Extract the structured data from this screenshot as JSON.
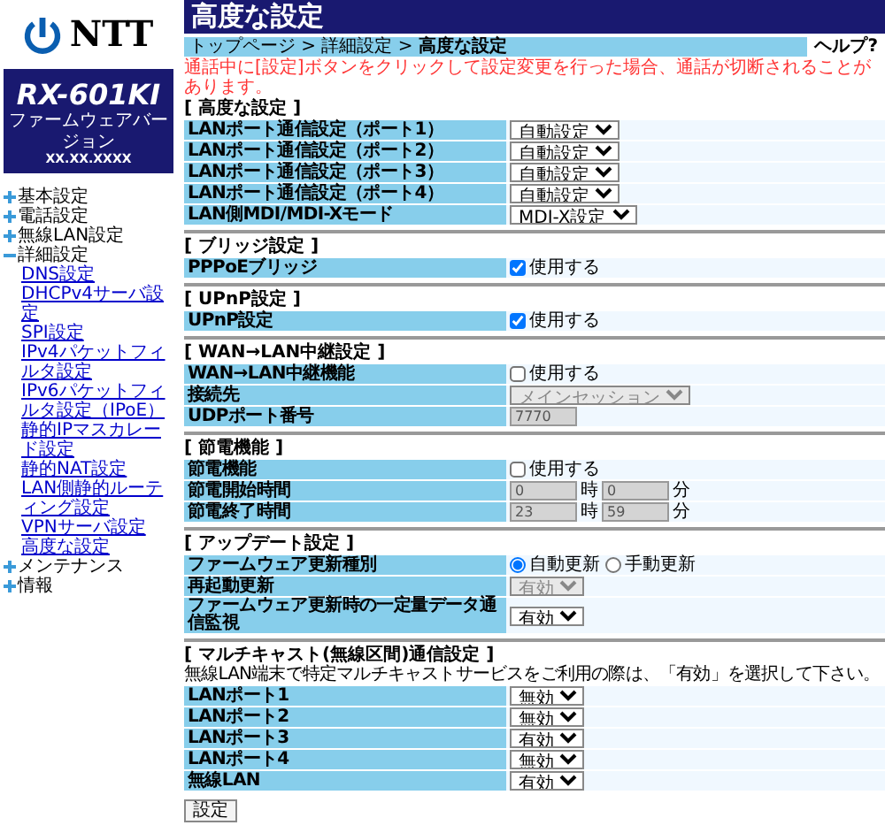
{
  "logo": {
    "text": "NTT"
  },
  "model": {
    "name": "RX-601KI",
    "firmware_label": "ファームウェアバージョン",
    "firmware_version": "XX.XX.XXXX"
  },
  "menu": [
    {
      "label": "基本設定",
      "expanded": false
    },
    {
      "label": "電話設定",
      "expanded": false
    },
    {
      "label": "無線LAN設定",
      "expanded": false
    },
    {
      "label": "詳細設定",
      "expanded": true,
      "children": [
        {
          "label": "DNS設定"
        },
        {
          "label": "DHCPv4サーバ設定"
        },
        {
          "label": "SPI設定"
        },
        {
          "label": "IPv4パケットフィルタ設定"
        },
        {
          "label": "IPv6パケットフィルタ設定（IPoE）"
        },
        {
          "label": "静的IPマスカレード設定"
        },
        {
          "label": "静的NAT設定"
        },
        {
          "label": "LAN側静的ルーティング設定"
        },
        {
          "label": "VPNサーバ設定"
        },
        {
          "label": "高度な設定"
        }
      ]
    },
    {
      "label": "メンテナンス",
      "expanded": false
    },
    {
      "label": "情報",
      "expanded": false
    }
  ],
  "page_title": "高度な設定",
  "breadcrumb": "トップページ > 詳細設定 > **高度な設定**",
  "help": "ヘルプ?",
  "warning": "通話中に[設定]ボタンをクリックして設定変更を行った場合、通話が切断されることがあります。",
  "sections": [
    {
      "title": "[ 高度な設定 ]",
      "rows": [
        {
          "label": "LANポート通信設定（ポート1）",
          "kind": "select",
          "value": "自動設定",
          "disabled": false
        },
        {
          "label": "LANポート通信設定（ポート2）",
          "kind": "select",
          "value": "自動設定",
          "disabled": false
        },
        {
          "label": "LANポート通信設定（ポート3）",
          "kind": "select",
          "value": "自動設定",
          "disabled": false
        },
        {
          "label": "LANポート通信設定（ポート4）",
          "kind": "select",
          "value": "自動設定",
          "disabled": false
        },
        {
          "label": "LAN側MDI/MDI-Xモード",
          "kind": "select",
          "value": "MDI-X設定",
          "disabled": false
        }
      ]
    },
    {
      "title": "[ ブリッジ設定 ]",
      "rows": [
        {
          "label": "PPPoEブリッジ",
          "kind": "checkbox",
          "text": "使用する",
          "checked": true
        }
      ]
    },
    {
      "title": "[ UPnP設定 ]",
      "rows": [
        {
          "label": "UPnP設定",
          "kind": "checkbox",
          "text": "使用する",
          "checked": true
        }
      ]
    },
    {
      "title": "[ WAN→LAN中継設定 ]",
      "rows": [
        {
          "label": "WAN→LAN中継機能",
          "kind": "checkbox",
          "text": "使用する",
          "checked": false
        },
        {
          "label": "接続先",
          "kind": "select",
          "value": "メインセッション",
          "disabled": true
        },
        {
          "label": "UDPポート番号",
          "kind": "text",
          "value": "7770",
          "disabled": true
        }
      ]
    },
    {
      "title": "[ 節電機能 ]",
      "rows": [
        {
          "label": "節電機能",
          "kind": "checkbox",
          "text": "使用する",
          "checked": false
        },
        {
          "label": "節電開始時間",
          "kind": "time",
          "disabled": true,
          "fields": [
            {
              "value": "0",
              "unit": "時"
            },
            {
              "value": "0",
              "unit": "分"
            }
          ]
        },
        {
          "label": "節電終了時間",
          "kind": "time",
          "disabled": true,
          "fields": [
            {
              "value": "23",
              "unit": "時"
            },
            {
              "value": "59",
              "unit": "分"
            }
          ]
        }
      ]
    },
    {
      "title": "[ アップデート設定 ]",
      "rows": [
        {
          "label": "ファームウェア更新種別",
          "kind": "radio",
          "options": [
            {
              "label": "自動更新",
              "selected": true
            },
            {
              "label": "手動更新",
              "selected": false
            }
          ]
        },
        {
          "label": "再起動更新",
          "kind": "select",
          "value": "有効",
          "disabled": true
        },
        {
          "label": "ファームウェア更新時の一定量データ通信監視",
          "kind": "select",
          "value": "有効",
          "disabled": false
        }
      ]
    },
    {
      "title": "[ マルチキャスト(無線区間)通信設定 ]",
      "description": "無線LAN端末で特定マルチキャストサービスをご利用の際は、「有効」を選択して下さい。",
      "rows": [
        {
          "label": "LANポート1",
          "kind": "select",
          "value": "無効",
          "disabled": false
        },
        {
          "label": "LANポート2",
          "kind": "select",
          "value": "無効",
          "disabled": false
        },
        {
          "label": "LANポート3",
          "kind": "select",
          "value": "有効",
          "disabled": false
        },
        {
          "label": "LANポート4",
          "kind": "select",
          "value": "無効",
          "disabled": false
        },
        {
          "label": "無線LAN",
          "kind": "select",
          "value": "有効",
          "disabled": false
        }
      ]
    }
  ],
  "submit": "設定"
}
